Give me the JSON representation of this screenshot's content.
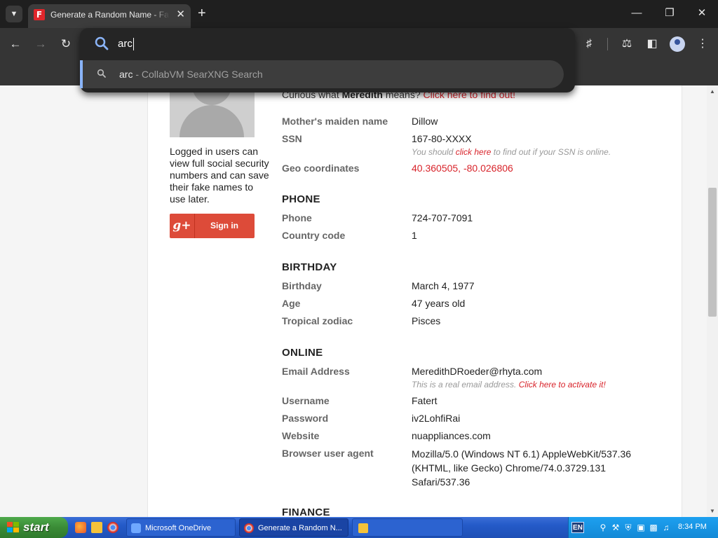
{
  "browser": {
    "tab_title": "Generate a Random Name - Fake Name Generator",
    "tab_favicon": "F",
    "omnibox_text": "arc",
    "suggestion_query": "arc",
    "suggestion_desc": " - CollabVM SearXNG Search"
  },
  "sidebar": {
    "login_note": "Logged in users can view full social security numbers and can save their fake names to use later.",
    "signin_icon": "g+",
    "signin_label": "Sign in"
  },
  "curious": {
    "prefix": "Curious what ",
    "name": "Meredith",
    "middle": " means? ",
    "link": "Click here to find out!"
  },
  "identity": {
    "maiden_label": "Mother's maiden name",
    "maiden_value": "Dillow",
    "ssn_label": "SSN",
    "ssn_value": "167-80-XXXX",
    "ssn_note_prefix": "You should ",
    "ssn_note_link": "click here",
    "ssn_note_suffix": " to find out if your SSN is online.",
    "geo_label": "Geo coordinates",
    "geo_value": "40.360505, -80.026806"
  },
  "phone": {
    "heading": "PHONE",
    "phone_label": "Phone",
    "phone_value": "724-707-7091",
    "cc_label": "Country code",
    "cc_value": "1"
  },
  "birthday": {
    "heading": "BIRTHDAY",
    "bday_label": "Birthday",
    "bday_value": "March 4, 1977",
    "age_label": "Age",
    "age_value": "47 years old",
    "zodiac_label": "Tropical zodiac",
    "zodiac_value": "Pisces"
  },
  "online": {
    "heading": "ONLINE",
    "email_label": "Email Address",
    "email_value": "MeredithDRoeder@rhyta.com",
    "email_note_prefix": "This is a real email address. ",
    "email_note_link": "Click here to activate it!",
    "user_label": "Username",
    "user_value": "Fatert",
    "pass_label": "Password",
    "pass_value": "iv2LohfiRai",
    "site_label": "Website",
    "site_value": "nuappliances.com",
    "ua_label": "Browser user agent",
    "ua_line1": "Mozilla/5.0 (Windows NT 6.1) AppleWebKit/537.36",
    "ua_line2": "(KHTML, like Gecko) Chrome/74.0.3729.131",
    "ua_line3": "Safari/537.36"
  },
  "finance": {
    "heading": "FINANCE"
  },
  "taskbar": {
    "start_label": "start",
    "task1": "Microsoft OneDrive",
    "task2": "Generate a Random N...",
    "lang": "EN",
    "time": "8:34 PM"
  },
  "colors": {
    "accent_red": "#d8232a",
    "google_red": "#dd4b39",
    "omnibox_accent": "#8ab4f8"
  }
}
